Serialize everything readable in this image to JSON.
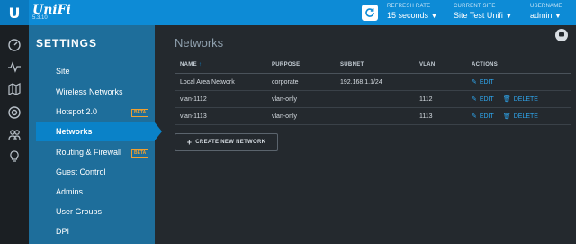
{
  "app": {
    "logo_letter": "U",
    "brand": "UniFi",
    "version": "5.3.10"
  },
  "topbar": {
    "refresh_label": "REFRESH RATE",
    "refresh_value": "15 seconds",
    "site_label": "CURRENT SITE",
    "site_value": "Site Test Unifi",
    "user_label": "USERNAME",
    "user_value": "admin"
  },
  "leftnav": {
    "icons": [
      "dashboard-icon",
      "statistics-icon",
      "map-icon",
      "devices-icon",
      "clients-icon",
      "insights-icon"
    ]
  },
  "sidebar": {
    "title": "SETTINGS",
    "items": [
      {
        "label": "Site",
        "beta": ""
      },
      {
        "label": "Wireless Networks",
        "beta": ""
      },
      {
        "label": "Hotspot 2.0",
        "beta": "BETA"
      },
      {
        "label": "Networks",
        "beta": ""
      },
      {
        "label": "Routing & Firewall",
        "beta": "BETA"
      },
      {
        "label": "Guest Control",
        "beta": ""
      },
      {
        "label": "Admins",
        "beta": ""
      },
      {
        "label": "User Groups",
        "beta": ""
      },
      {
        "label": "DPI",
        "beta": ""
      }
    ]
  },
  "main": {
    "title": "Networks",
    "columns": {
      "name": "NAME",
      "sort_arrow": "↑",
      "purpose": "PURPOSE",
      "subnet": "SUBNET",
      "vlan": "VLAN",
      "actions": "ACTIONS"
    },
    "rows": [
      {
        "name": "Local Area Network",
        "purpose": "corporate",
        "subnet": "192.168.1.1/24",
        "vlan": "",
        "edit": "EDIT",
        "delete": ""
      },
      {
        "name": "vlan-1112",
        "purpose": "vlan-only",
        "subnet": "",
        "vlan": "1112",
        "edit": "EDIT",
        "delete": "DELETE"
      },
      {
        "name": "vlan-1113",
        "purpose": "vlan-only",
        "subnet": "",
        "vlan": "1113",
        "edit": "EDIT",
        "delete": "DELETE"
      }
    ],
    "create_label": "CREATE NEW NETWORK"
  },
  "colors": {
    "accent": "#0d8bd6",
    "sidebar": "#1e6e9b",
    "active": "#0a82c8",
    "background": "#24292e",
    "beta": "#f0a030"
  }
}
